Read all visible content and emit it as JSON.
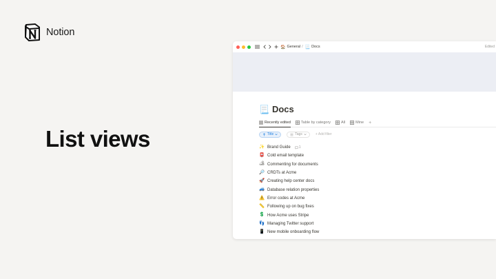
{
  "brand": {
    "name": "Notion",
    "logo_icon": "notion-logo-icon"
  },
  "headline": "List views",
  "window": {
    "traffic_lights": [
      "#ff5f57",
      "#febc2e",
      "#28c840"
    ],
    "breadcrumb": [
      {
        "icon": "🏠",
        "label": "General"
      },
      {
        "icon": "📃",
        "label": "Docs"
      }
    ],
    "edited_label": "Edited"
  },
  "page": {
    "icon": "📃",
    "title": "Docs",
    "views": [
      {
        "label": "Recently edited",
        "icon": "list-icon",
        "active": true
      },
      {
        "label": "Table by category",
        "icon": "table-icon",
        "active": false
      },
      {
        "label": "All",
        "icon": "table-icon",
        "active": false
      },
      {
        "label": "Mine",
        "icon": "table-icon",
        "active": false
      }
    ],
    "add_view": "+",
    "filters": [
      {
        "label": "Title",
        "style": "blue",
        "icon": "arrow-up-icon"
      },
      {
        "label": "Tags",
        "style": "grey",
        "icon": "list-icon"
      }
    ],
    "add_filter": "+ Add filter",
    "items": [
      {
        "icon": "✨",
        "label": "Brand Guide",
        "comments": "1"
      },
      {
        "icon": "📮",
        "label": "Cold email template"
      },
      {
        "icon": "🏕",
        "label": "Commenting for documents"
      },
      {
        "icon": "🔎",
        "label": "CRDTs at Acme"
      },
      {
        "icon": "🚀",
        "label": "Creating help center docs"
      },
      {
        "icon": "🚙",
        "label": "Database relation properties"
      },
      {
        "icon": "⚠️",
        "label": "Error codes at Acme"
      },
      {
        "icon": "📏",
        "label": "Following up on bug fixes"
      },
      {
        "icon": "💲",
        "label": "How Acme uses Stripe"
      },
      {
        "icon": "👣",
        "label": "Managing Twitter support"
      },
      {
        "icon": "📱",
        "label": "New mobile onboarding flow"
      }
    ]
  },
  "colors": {
    "background": "#f5f4f2",
    "accent": "#2383e2",
    "cover": "#eceef4"
  }
}
